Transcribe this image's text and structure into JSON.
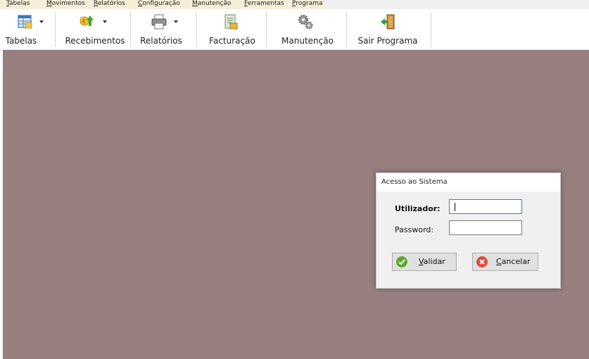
{
  "menu": {
    "items": [
      {
        "label": "Tabelas"
      },
      {
        "label": "Movimentos"
      },
      {
        "label": "Relatórios"
      },
      {
        "label": "Configuração"
      },
      {
        "label": "Manutenção"
      },
      {
        "label": "Ferramentas"
      },
      {
        "label": "Programa"
      }
    ]
  },
  "toolbar": {
    "buttons": [
      {
        "label": "Tabelas",
        "icon": "table-grid-icon"
      },
      {
        "label": "Recebimentos",
        "icon": "money-receive-icon"
      },
      {
        "label": "Relatórios",
        "icon": "printer-icon"
      },
      {
        "label": "Facturação",
        "icon": "invoice-icon"
      },
      {
        "label": "Manutenção",
        "icon": "gears-icon"
      },
      {
        "label": "Sair Programa",
        "icon": "exit-door-icon"
      }
    ]
  },
  "dialog": {
    "title": "Acesso ao Sistema",
    "user_label": "Utilizador:",
    "user_value": "",
    "password_label": "Password:",
    "password_value": "",
    "validate_label": "Validar",
    "cancel_label": "Cancelar"
  },
  "colors": {
    "workspace": "#967f7e",
    "menubar_highlight": "#f5efd9",
    "validate_icon": "#5aaa2a",
    "cancel_icon": "#e04a3a"
  }
}
